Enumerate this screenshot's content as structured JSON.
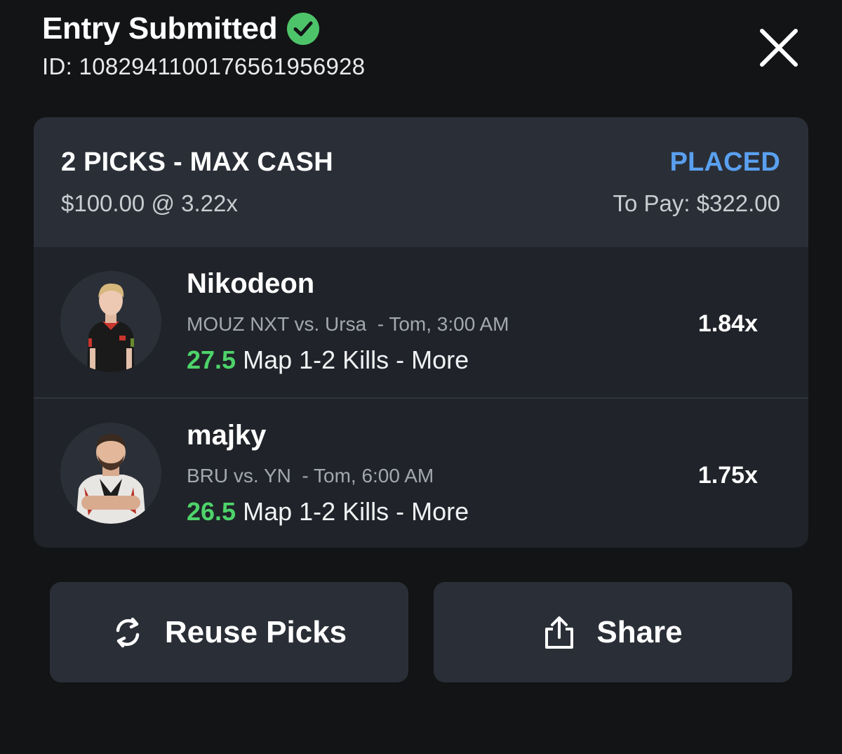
{
  "header": {
    "title": "Entry Submitted",
    "entry_id": "ID: 1082941100176561956928",
    "check_icon": "check-circle-icon",
    "close_icon": "close-icon"
  },
  "entry": {
    "title": "2 PICKS - MAX CASH",
    "status": "PLACED",
    "stake": "$100.00 @ 3.22x",
    "to_pay": "To Pay: $322.00",
    "picks": [
      {
        "player": "Nikodeon",
        "match": "MOUZ NXT vs. Ursa  - Tom, 3:00 AM",
        "line": "27.5",
        "market": " Map 1-2 Kills - More",
        "multiplier": "1.84x"
      },
      {
        "player": "majky",
        "match": "BRU vs. YN  - Tom, 6:00 AM",
        "line": "26.5",
        "market": " Map 1-2 Kills - More",
        "multiplier": "1.75x"
      }
    ]
  },
  "actions": {
    "reuse_label": "Reuse Picks",
    "reuse_icon": "refresh-icon",
    "share_label": "Share",
    "share_icon": "share-icon"
  },
  "colors": {
    "background": "#131416",
    "card": "#202329",
    "card_header": "#2a2f37",
    "status_blue": "#5aa0f0",
    "line_green": "#4ed36a",
    "check_green": "#4ec46a"
  }
}
